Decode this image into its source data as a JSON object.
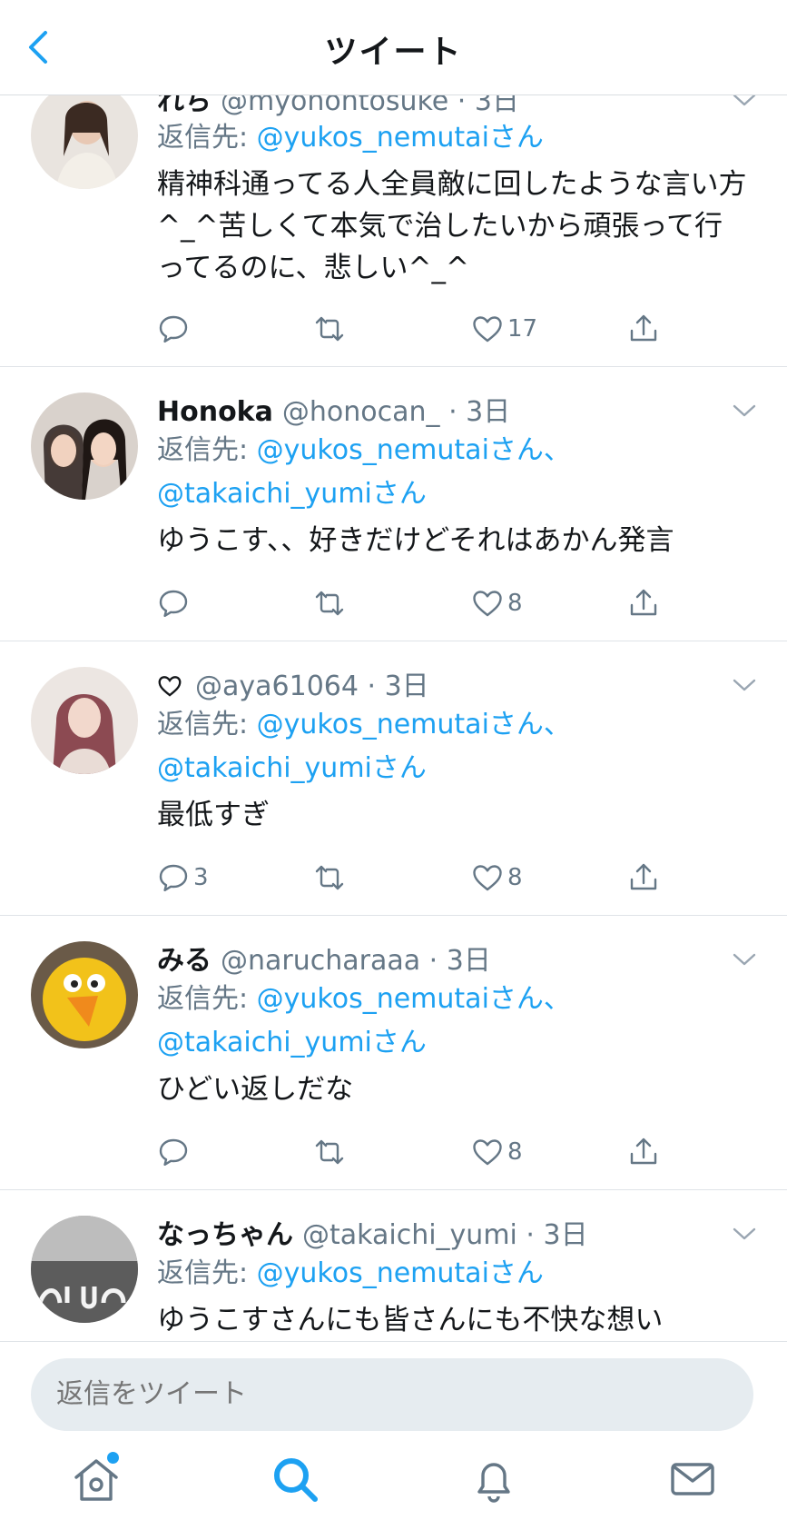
{
  "nav": {
    "title": "ツイート"
  },
  "reply_prefix": "返信先:",
  "tweets": [
    {
      "name": "れち",
      "handle": "@myohohtosuke",
      "time": "3日",
      "reply_to": [
        "@yukos_nemutaiさん"
      ],
      "text": "精神科通ってる人全員敵に回したような言い方^_^苦しくて本気で治したいから頑張って行ってるのに、悲しい^_^",
      "replies": "",
      "likes": "17"
    },
    {
      "name": "Honoka",
      "handle": "@honocan_",
      "time": "3日",
      "reply_to": [
        "@yukos_nemutaiさん、",
        "@takaichi_yumiさん"
      ],
      "text": "ゆうこす、、好きだけどそれはあかん発言",
      "replies": "",
      "likes": "8"
    },
    {
      "name": "",
      "handle": "@aya61064",
      "time": "3日",
      "reply_to": [
        "@yukos_nemutaiさん、",
        "@takaichi_yumiさん"
      ],
      "text": "最低すぎ",
      "replies": "3",
      "likes": "8"
    },
    {
      "name": "みる",
      "handle": "@narucharaaa",
      "time": "3日",
      "reply_to": [
        "@yukos_nemutaiさん、",
        "@takaichi_yumiさん"
      ],
      "text": "ひどい返しだな",
      "replies": "",
      "likes": "8"
    },
    {
      "name": "なっちゃん",
      "handle": "@takaichi_yumi",
      "time": "3日",
      "reply_to": [
        "@yukos_nemutaiさん"
      ],
      "text": "ゆうこすさんにも皆さんにも不快な想い",
      "replies": "",
      "likes": ""
    }
  ],
  "compose": {
    "placeholder": "返信をツイート"
  },
  "colors": {
    "accent": "#1da1f2",
    "secondary_text": "#657786",
    "divider": "#dfe3e7"
  },
  "icons": {
    "tweet_actions": [
      "reply-icon",
      "retweet-icon",
      "like-icon",
      "share-icon"
    ],
    "tabs": [
      "home-icon",
      "search-icon",
      "notifications-icon",
      "messages-icon"
    ]
  }
}
